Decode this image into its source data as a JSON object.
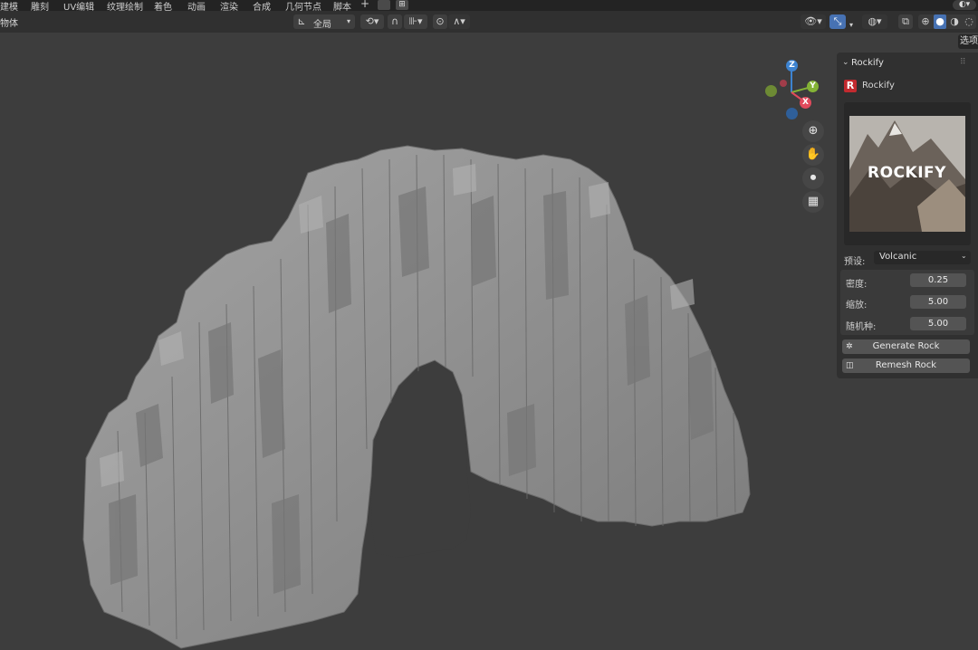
{
  "topbar": {
    "tabs": [
      "建模",
      "雕刻",
      "UV编辑",
      "纹理绘制",
      "着色",
      "动画",
      "渲染",
      "合成",
      "几何节点",
      "脚本"
    ],
    "add_label": "+"
  },
  "header": {
    "left_label": "物体",
    "transform_orientation": "全局",
    "options_label": "选项"
  },
  "panel": {
    "title": "Rockify",
    "logo_letter": "R",
    "addon_name": "Rockify",
    "thumbnail_text": "ROCKIFY",
    "preset_label": "预设:",
    "preset_value": "Volcanic",
    "density_label": "密度:",
    "density_value": "0.25",
    "scale_label": "缩放:",
    "scale_value": "5.00",
    "seed_label": "随机种:",
    "seed_value": "5.00",
    "generate_label": "Generate Rock",
    "remesh_label": "Remesh Rock"
  },
  "gizmo": {
    "z": "Z",
    "y": "Y",
    "x": "X"
  },
  "colors": {
    "accent": "#4772b3",
    "logo_red": "#c22a2f",
    "axis_x": "#e04a5c",
    "axis_y": "#84b336",
    "axis_z": "#3d83d0",
    "rock": "#8d8d8d"
  }
}
